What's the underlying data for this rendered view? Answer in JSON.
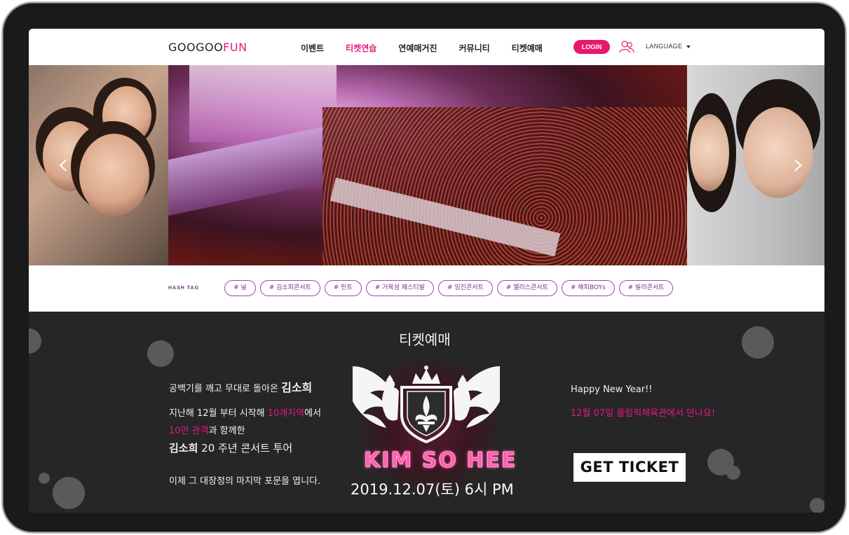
{
  "header": {
    "logo_part1": "GOOGOO",
    "logo_part2": "FUN",
    "nav": [
      {
        "label": "이벤트",
        "active": false
      },
      {
        "label": "티켓연습",
        "active": true
      },
      {
        "label": "연예매거진",
        "active": false
      },
      {
        "label": "커뮤니티",
        "active": false
      },
      {
        "label": "티켓예매",
        "active": false
      }
    ],
    "login_label": "LOGIN",
    "user_icon": "user-group-icon",
    "language_label": "LANGUAGE",
    "language_icon": "caret-down-icon"
  },
  "hero": {
    "prev_icon": "chevron-left-icon",
    "next_icon": "chevron-right-icon",
    "prev_glyph": "‹",
    "next_glyph": "›"
  },
  "hashtags": {
    "label": "HASH TAG",
    "tags": [
      "# 널",
      "# 김소희콘서트",
      "# 민트",
      "# 거북섬 페스티발",
      "# 잉진콘서트",
      "# 엘리스콘서트",
      "# 해피BOYs",
      "# 빌리콘서트"
    ]
  },
  "ticket": {
    "title": "티켓예매",
    "left": {
      "line1_prefix": "공백기를 깨고 무대로 돌아온 ",
      "line1_name": "김소희",
      "line2_prefix": "지난해 12월 부터 시작해 ",
      "line2_highlight": "10개지역",
      "line2_suffix": "에서",
      "line3_highlight": "10만 관객",
      "line3_suffix": "과 함께한",
      "line4_name": "김소희",
      "line4_suffix": " 20 주년 콘서트 투어",
      "line5": "이제 그 대장정의 마지막 포문을 엽니다."
    },
    "poster_icon": "royal-crest-emblem-icon",
    "poster_name": "KIM SO HEE",
    "date": "2019.12.07(토) 6시 PM",
    "right": {
      "greeting": "Happy New Year!!",
      "venue_line": "12월 07일 올림픽체육관에서 만나요!"
    },
    "cta_label": "GET TICKET"
  },
  "colors": {
    "brand_pink": "#e6197c",
    "hashtag_purple": "#7a2e8a",
    "ticket_bg": "#262626"
  }
}
